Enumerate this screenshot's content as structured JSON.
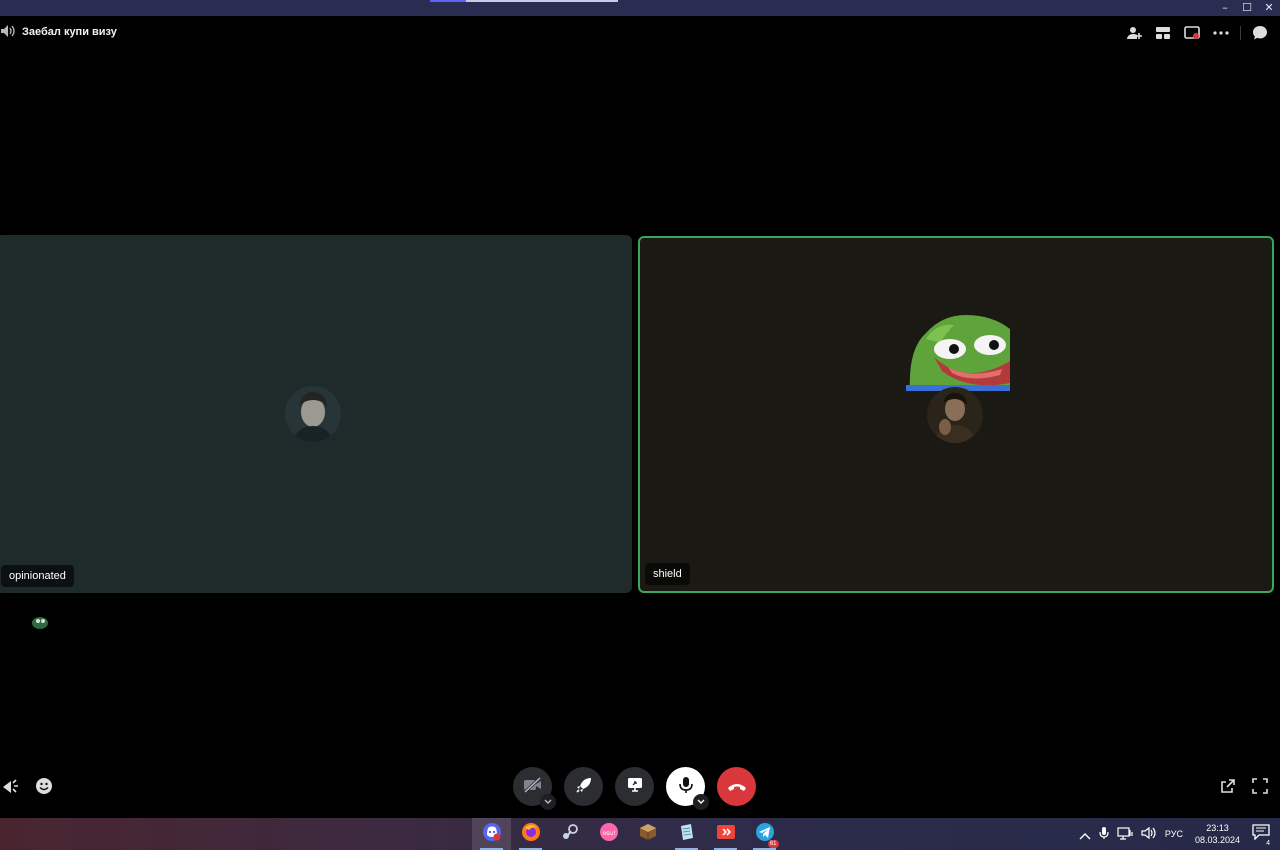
{
  "call": {
    "title": "Заебал купи визу"
  },
  "participants": [
    {
      "name": "opinionated",
      "speaking": false
    },
    {
      "name": "shield",
      "speaking": true
    }
  ],
  "colors": {
    "speaking_border": "#3ba55c",
    "hangup": "#da373c",
    "tile_left": "#1f2a2a",
    "tile_right": "#1b1913"
  },
  "top_tools": [
    {
      "icon": "add-person-icon"
    },
    {
      "icon": "grid-layout-icon"
    },
    {
      "icon": "popout-icon"
    },
    {
      "icon": "more-icon"
    },
    {
      "icon": "chat-icon"
    }
  ],
  "controls": [
    {
      "icon": "camera-off-icon"
    },
    {
      "icon": "activity-rocket-icon"
    },
    {
      "icon": "screen-share-icon"
    },
    {
      "icon": "microphone-icon"
    },
    {
      "icon": "hang-up-icon"
    }
  ],
  "taskbar": {
    "apps": [
      "discord",
      "firefox",
      "steam",
      "osu",
      "minecraft",
      "notes",
      "anydesk",
      "telegram"
    ],
    "lang": "РУС",
    "time": "23:13",
    "date": "08.03.2024",
    "notifications": "4",
    "telegram_badge": "61"
  }
}
